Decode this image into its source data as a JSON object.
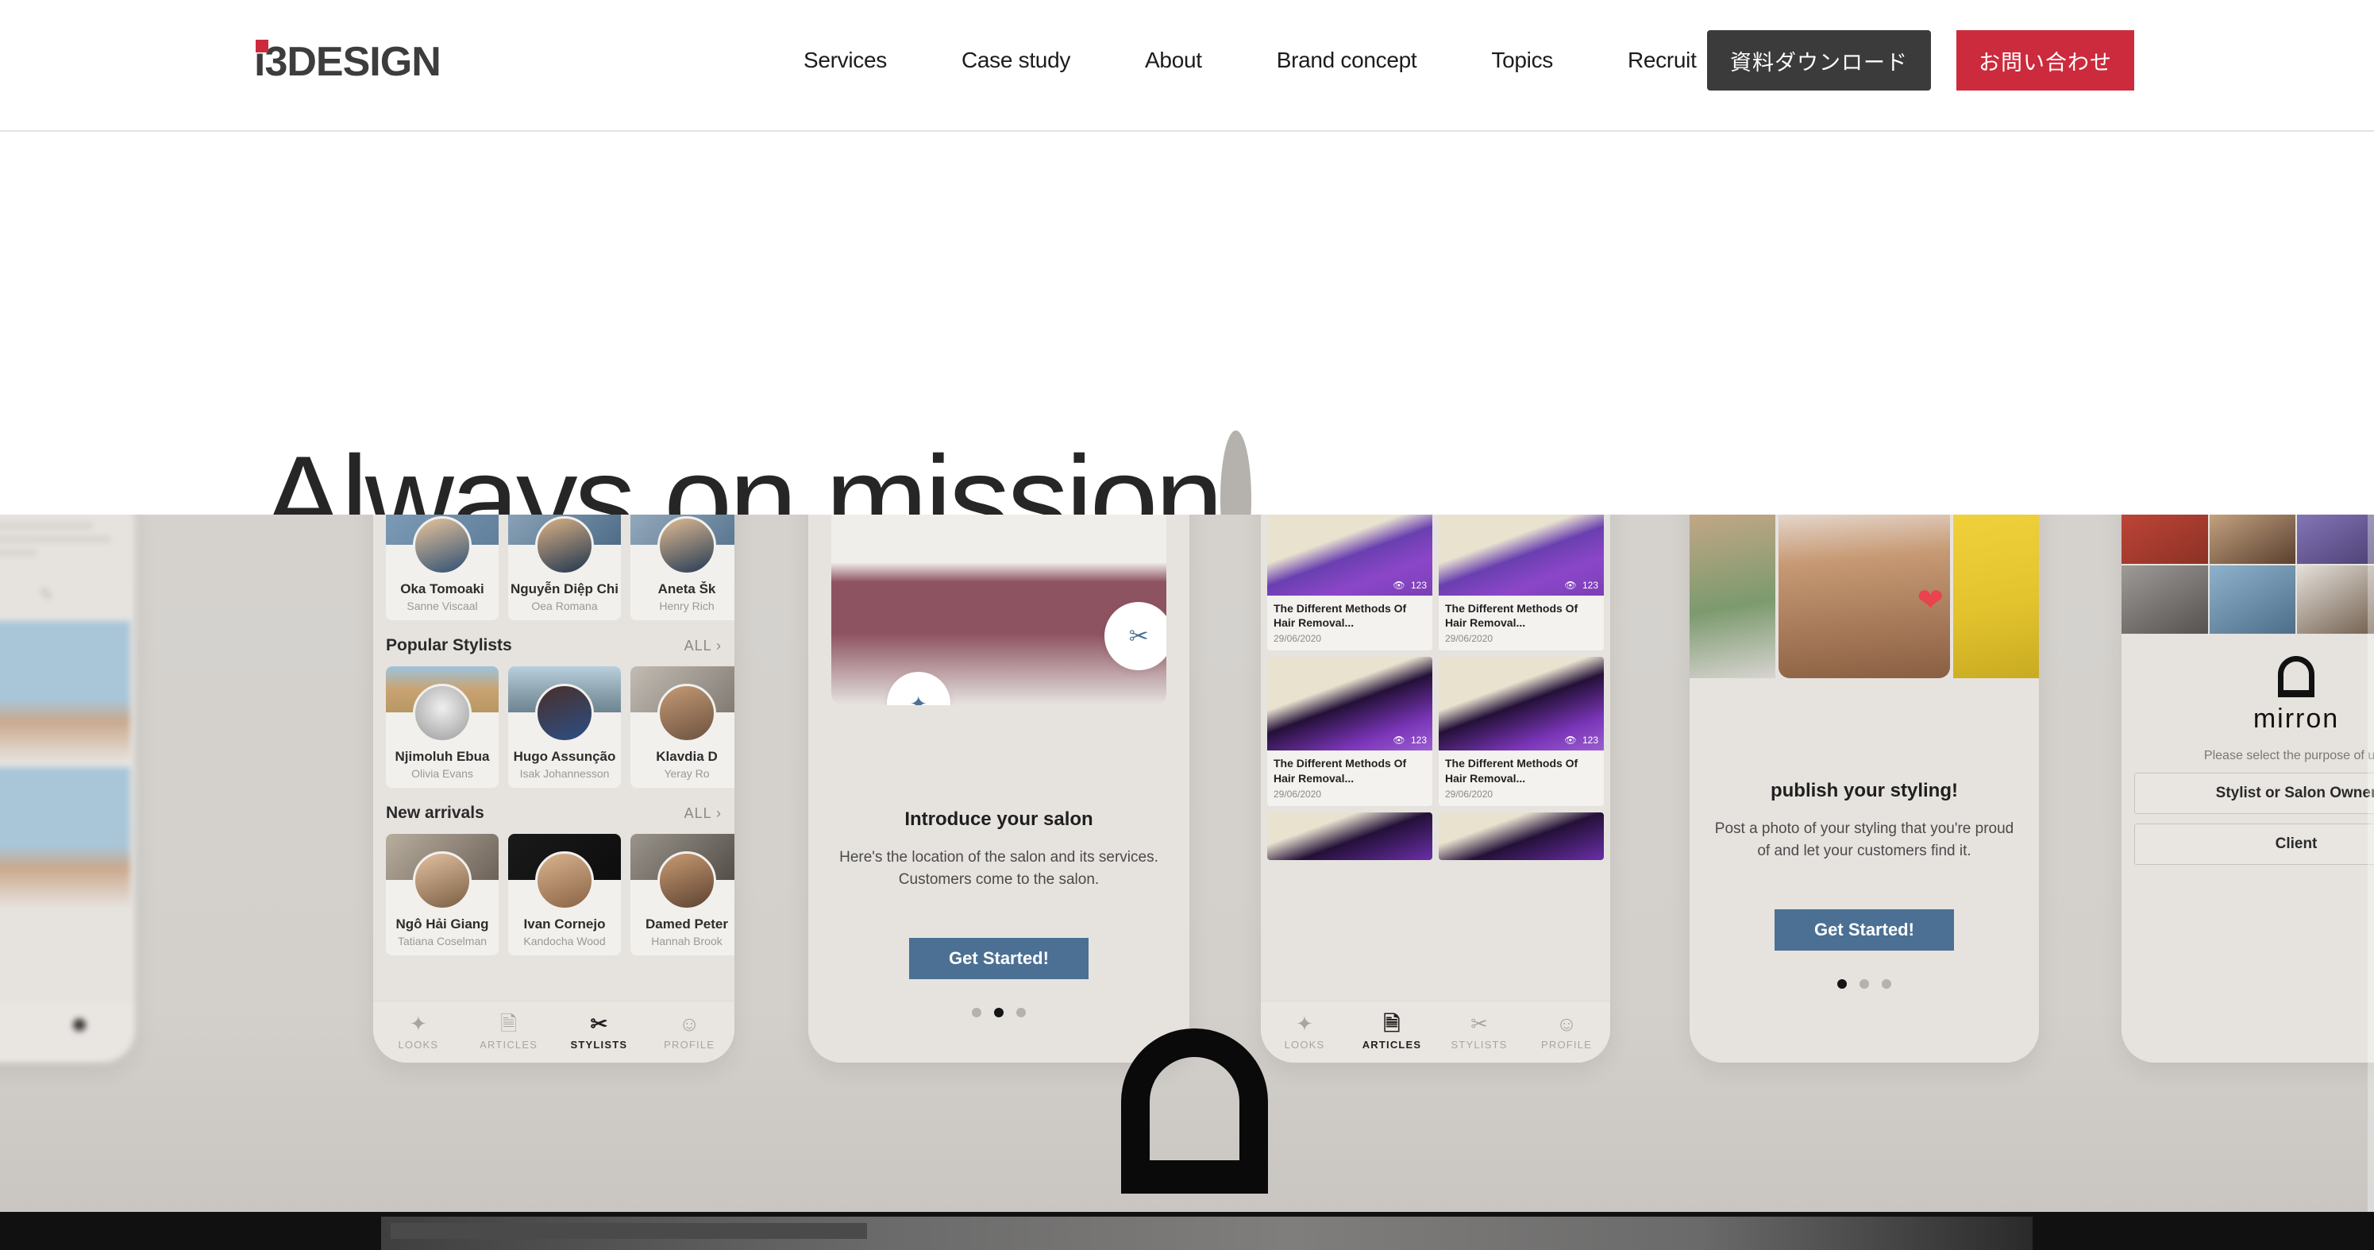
{
  "header": {
    "logo": {
      "prefix": "i",
      "rest": "3DESIGN",
      "dot_color": "#cc2b3d"
    },
    "nav": [
      {
        "label": "Services"
      },
      {
        "label": "Case study"
      },
      {
        "label": "About"
      },
      {
        "label": "Brand concept"
      },
      {
        "label": "Topics"
      },
      {
        "label": "Recruit"
      }
    ],
    "download_button": "資料ダウンロード",
    "contact_button": "お問い合わせ",
    "download_bg": "#3b3b3b",
    "contact_bg": "#cc2b3d"
  },
  "hero": {
    "headline": "Always on mission",
    "headline_dot": "."
  },
  "showcase": {
    "phone_stylists": {
      "top_cards": [
        {
          "name": "Oka Tomoaki",
          "sub": "Sanne Viscaal"
        },
        {
          "name": "Nguyễn Diệp Chi",
          "sub": "Oea Romana"
        },
        {
          "name": "Aneta Šk",
          "sub": "Henry Rich"
        }
      ],
      "section_popular": {
        "title": "Popular Stylists",
        "all": "ALL"
      },
      "popular_cards": [
        {
          "name": "Njimoluh Ebua",
          "sub": "Olivia Evans"
        },
        {
          "name": "Hugo Assunção",
          "sub": "Isak Johannesson"
        },
        {
          "name": "Klavdia D",
          "sub": "Yeray Ro"
        }
      ],
      "section_new": {
        "title": "New arrivals",
        "all": "ALL"
      },
      "new_cards": [
        {
          "name": "Ngô Hải Giang",
          "sub": "Tatiana Coselman"
        },
        {
          "name": "Ivan Cornejo",
          "sub": "Kandocha Wood"
        },
        {
          "name": "Damed Peter",
          "sub": "Hannah Brook"
        }
      ],
      "tabs": [
        {
          "label": "LOOKS",
          "icon": "sparkle-icon",
          "active": false
        },
        {
          "label": "ARTICLES",
          "icon": "document-icon",
          "active": false
        },
        {
          "label": "STYLISTS",
          "icon": "scissors-icon",
          "active": true
        },
        {
          "label": "PROFILE",
          "icon": "person-icon",
          "active": false
        }
      ]
    },
    "phone_onboard_salon": {
      "title": "Introduce your salon",
      "desc": "Here's the location of the salon and its services. Customers come to the salon.",
      "button": "Get Started!",
      "dots": [
        false,
        true,
        false
      ]
    },
    "phone_articles": {
      "cards": [
        {
          "title": "The Different Methods Of Hair Removal...",
          "date": "29/06/2020",
          "views": "123"
        },
        {
          "title": "The Different Methods Of Hair Removal...",
          "date": "29/06/2020",
          "views": "123"
        },
        {
          "title": "The Different Methods Of Hair Removal...",
          "date": "29/06/2020",
          "views": "123"
        },
        {
          "title": "The Different Methods Of Hair Removal...",
          "date": "29/06/2020",
          "views": "123"
        }
      ],
      "tabs": [
        {
          "label": "LOOKS",
          "icon": "sparkle-icon",
          "active": false
        },
        {
          "label": "ARTICLES",
          "icon": "document-icon",
          "active": true
        },
        {
          "label": "STYLISTS",
          "icon": "scissors-icon",
          "active": false
        },
        {
          "label": "PROFILE",
          "icon": "person-icon",
          "active": false
        }
      ]
    },
    "phone_onboard_styling": {
      "title": "publish your styling!",
      "desc": "Post a photo of your styling that you're proud of and let your customers find it.",
      "button": "Get Started!",
      "dots": [
        true,
        false,
        false
      ]
    },
    "phone_welcome": {
      "brand": "mirron",
      "prompt": "Please select the purpose of use",
      "option_stylist": "Stylist or Salon Owner",
      "option_client": "Client"
    }
  }
}
